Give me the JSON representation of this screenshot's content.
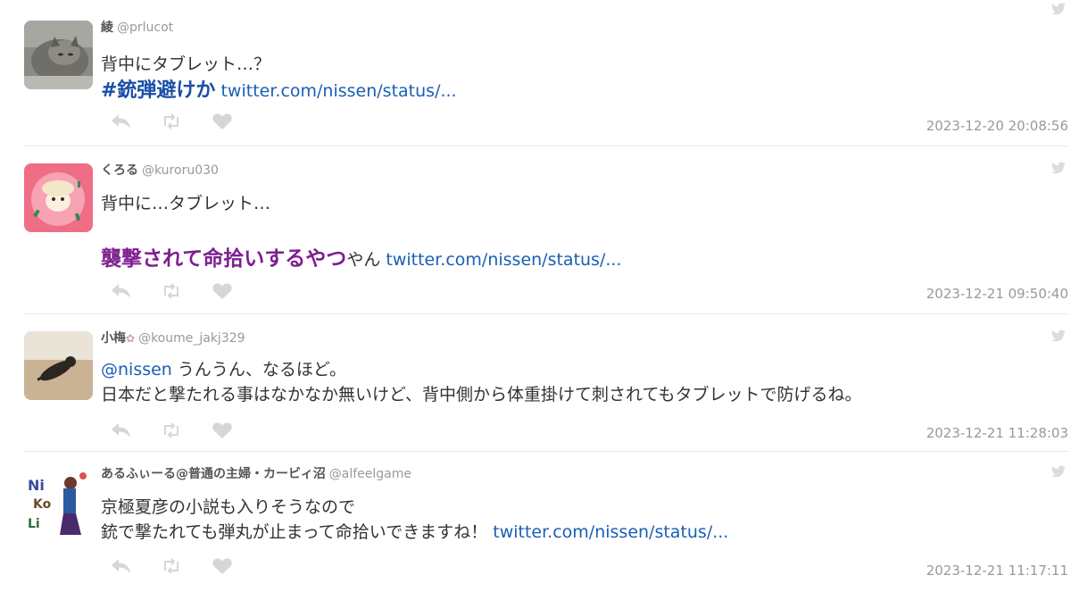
{
  "tweets": [
    {
      "user": "綾",
      "handle": "@prlucot",
      "lines": [
        "背中にタブレット…？"
      ],
      "hashtag": "#銃弾避けか",
      "link": "twitter.com/nissen/status/...",
      "time": "2023-12-20 20:08:56",
      "avatar": "cat-avatar"
    },
    {
      "user": "くろる",
      "handle": "@kuroru030",
      "lines": [
        "背中に…タブレット…"
      ],
      "highlight": "襲撃されて命拾いするやつ",
      "suffix": "やん",
      "link": "twitter.com/nissen/status/...",
      "time": "2023-12-21 09:50:40",
      "avatar": "cake-avatar"
    },
    {
      "user": "小梅",
      "handle": "@koume_jakj329",
      "mention": "@nissen",
      "lines": [
        "うんうん、なるほど。",
        "日本だと撃たれる事はなかなか無いけど、背中側から体重掛けて刺されてもタブレットで防げるね。"
      ],
      "time": "2023-12-21 11:28:03",
      "avatar": "cat-floor-avatar"
    },
    {
      "user": "あるふぃーる@普通の主婦・カービィ沼",
      "handle": "@alfeelgame",
      "lines": [
        "京極夏彦の小説も入りそうなので",
        "銃で撃たれても弾丸が止まって命拾いできますね！"
      ],
      "link": "twitter.com/nissen/status/...",
      "time": "2023-12-21 11:17:11",
      "avatar": "illustration-avatar"
    }
  ],
  "icons": {
    "reply": "reply-icon",
    "retweet": "retweet-icon",
    "like": "heart-icon",
    "source": "twitter-bird-icon"
  },
  "colors": {
    "link": "#1a5fb4",
    "hashtag": "#1a4fa8",
    "highlight": "#7f1f90",
    "muted": "#999999",
    "icon": "#d6d6d6"
  }
}
